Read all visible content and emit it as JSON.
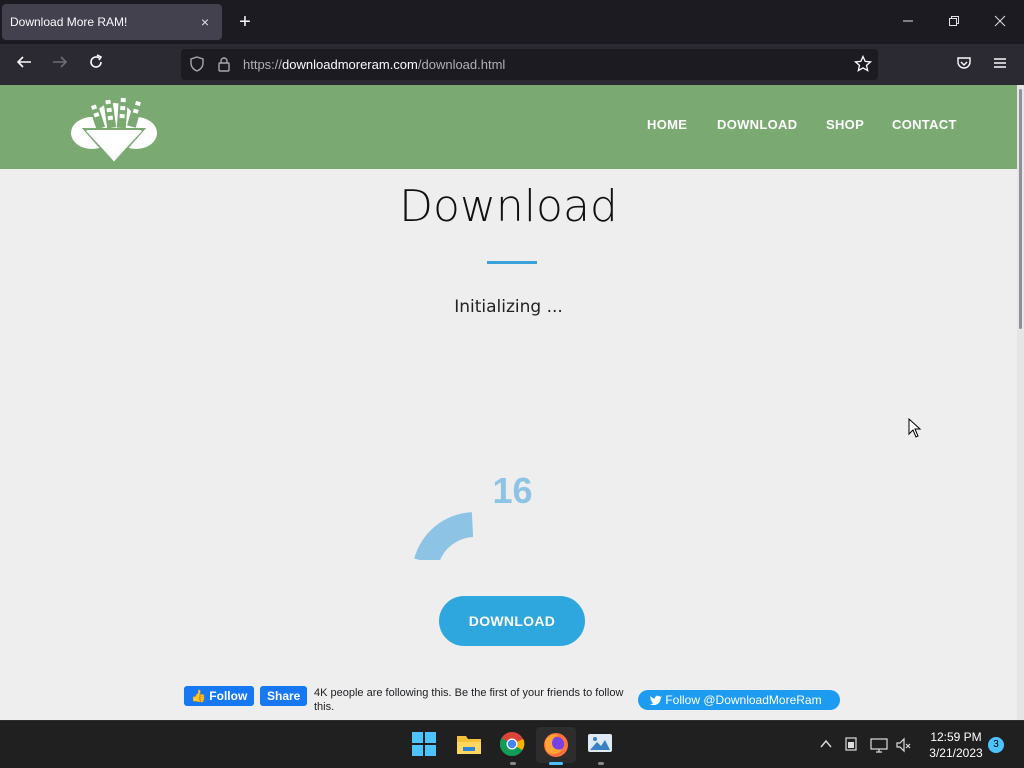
{
  "browser": {
    "tab_title": "Download More RAM!",
    "tab_close": "×",
    "new_tab": "+",
    "url_scheme": "https://",
    "url_host": "downloadmoreram.com",
    "url_path": "/download.html"
  },
  "site": {
    "nav": [
      "HOME",
      "DOWNLOAD",
      "SHOP",
      "CONTACT"
    ],
    "heading": "Download",
    "status": "Initializing ...",
    "gauge_value": "16",
    "gauge_fraction": 0.2,
    "download_label": "DOWNLOAD",
    "colors": {
      "header": "#7aaa72",
      "accent": "#2ea7df",
      "gauge": "#8dc4e6"
    }
  },
  "social": {
    "fb_follow": "Follow",
    "fb_share": "Share",
    "fb_text": "4K people are following this. Be the first of your friends to follow this.",
    "twitter": "Follow @DownloadMoreRam"
  },
  "taskbar": {
    "time": "12:59 PM",
    "date": "3/21/2023",
    "notifications": "3"
  }
}
